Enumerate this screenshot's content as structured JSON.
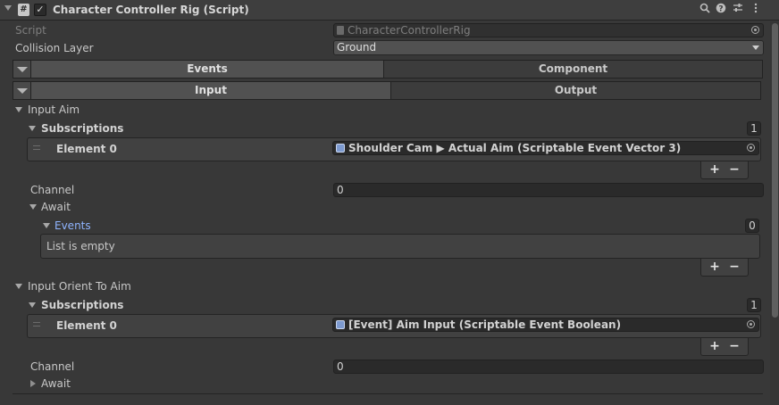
{
  "header": {
    "title": "Character Controller Rig (Script)",
    "script_icon_glyph": "#",
    "checkbox_glyph": "✓",
    "icons": [
      "search-icon",
      "help-icon",
      "preset-sliders-icon",
      "kebab-menu-icon"
    ]
  },
  "props": {
    "script_label": "Script",
    "script_value": "CharacterControllerRig",
    "collision_label": "Collision Layer",
    "collision_value": "Ground"
  },
  "tabs_top": [
    "Events",
    "Component"
  ],
  "tabs_sub": [
    "Input",
    "Output"
  ],
  "input_aim": {
    "label": "Input Aim",
    "subs_label": "Subscriptions",
    "subs_count": "1",
    "element_label": "Element 0",
    "element_value": "Shoulder Cam ▶ Actual Aim (Scriptable Event Vector 3)",
    "channel_label": "Channel",
    "channel_value": "0",
    "await_label": "Await",
    "events_label": "Events",
    "events_count": "0",
    "empty_text": "List is empty"
  },
  "input_orient": {
    "label": "Input Orient To Aim",
    "subs_label": "Subscriptions",
    "subs_count": "1",
    "element_label": "Element 0",
    "element_value": "[Event] Aim Input (Scriptable Event Boolean)",
    "channel_label": "Channel",
    "channel_value": "0",
    "await_label": "Await"
  },
  "buttons": {
    "plus": "+",
    "minus": "−"
  },
  "colors": {
    "background": "#383838",
    "field": "#2a2a2a",
    "link": "#8fb4ff",
    "active_tab": "#515151"
  }
}
